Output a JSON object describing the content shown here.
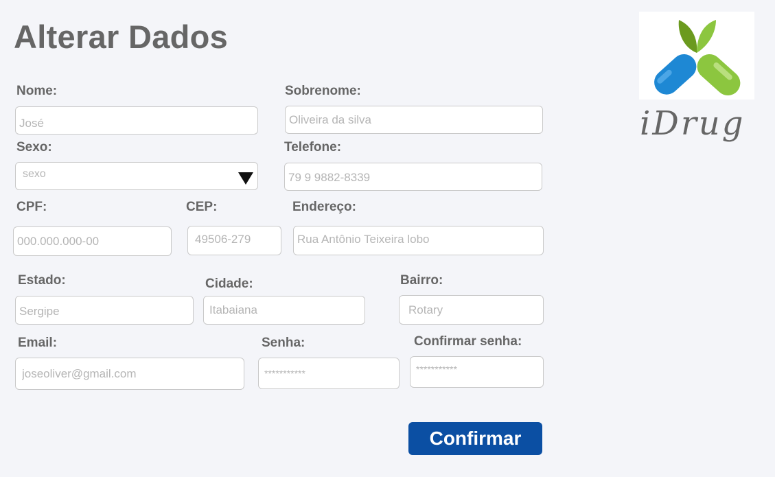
{
  "page": {
    "title": "Alterar Dados"
  },
  "brand": {
    "name": "iDrug"
  },
  "form": {
    "nome": {
      "label": "Nome:",
      "placeholder": "José"
    },
    "sobrenome": {
      "label": "Sobrenome:",
      "placeholder": "Oliveira da silva"
    },
    "sexo": {
      "label": "Sexo:",
      "value": "sexo"
    },
    "telefone": {
      "label": "Telefone:",
      "placeholder": "79 9 9882-8339"
    },
    "cpf": {
      "label": "CPF:",
      "placeholder": "000.000.000-00"
    },
    "cep": {
      "label": "CEP:",
      "placeholder": "49506-279"
    },
    "endereco": {
      "label": "Endereço:",
      "placeholder": "Rua Antônio Teixeira lobo"
    },
    "estado": {
      "label": "Estado:",
      "placeholder": "Sergipe"
    },
    "cidade": {
      "label": "Cidade:",
      "placeholder": "Itabaiana"
    },
    "bairro": {
      "label": "Bairro:",
      "placeholder": "Rotary"
    },
    "email": {
      "label": "Email:",
      "placeholder": "joseoliver@gmail.com"
    },
    "senha": {
      "label": "Senha:",
      "placeholder": "***********"
    },
    "confirmar_senha": {
      "label": "Confirmar senha:",
      "placeholder": "***********"
    },
    "confirm_button": "Confirmar"
  },
  "colors": {
    "background": "#f4f5f9",
    "label": "#666666",
    "button": "#0b4fa3",
    "logo_blue": "#1e88d4",
    "logo_green": "#8cc63f",
    "leaf_dark": "#6b9a1e"
  },
  "icons": {
    "logo": "pill-leaf-logo",
    "dropdown": "triangle-down-icon"
  }
}
